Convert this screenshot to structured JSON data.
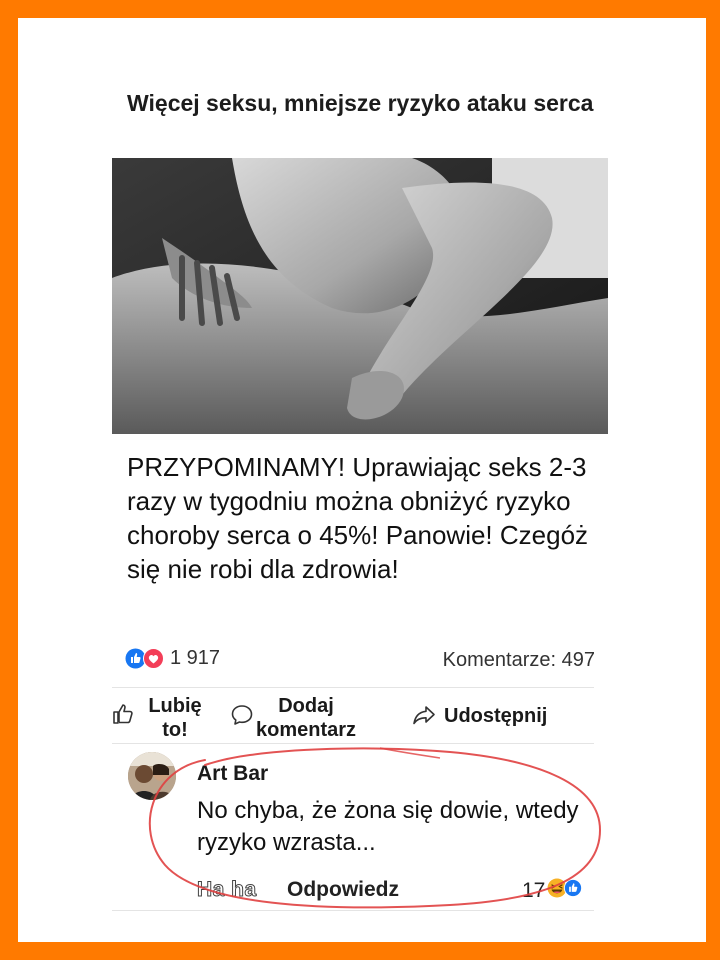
{
  "post": {
    "title": "Więcej seksu, mniejsze ryzyko ataku serca",
    "text": "PRZYPOMINAMY! Uprawiając seks 2-3 razy w tygodniu można obniżyć ryzyko choroby serca o 45%! Panowie! Czegóż się nie robi dla zdrowia!",
    "reactions_count": "1 917",
    "comments_count": "Komentarze: 497"
  },
  "actions": {
    "like_label": "Lubię to!",
    "comment_label": "Dodaj komentarz",
    "share_label": "Udostępnij"
  },
  "comment": {
    "author": "Art Bar",
    "text": "No chyba, że żona się dowie, wtedy ryzyko wzrasta...",
    "haha_label": "Ha ha",
    "reply_label": "Odpowiedz",
    "reactions_count": "17"
  },
  "colors": {
    "frame": "#ff7a00",
    "annotation": "#e04040",
    "like_blue": "#1877f2",
    "love_red": "#f33e58",
    "haha_yellow": "#f7b125"
  },
  "icons": {
    "like": "thumbs-up-icon",
    "comment": "speech-bubble-icon",
    "share": "share-arrow-icon"
  }
}
